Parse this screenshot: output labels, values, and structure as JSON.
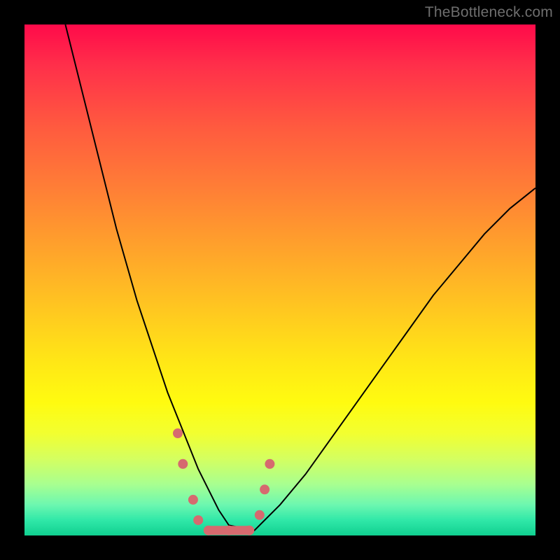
{
  "watermark": "TheBottleneck.com",
  "colors": {
    "background": "#000000",
    "gradient_top": "#ff0a4a",
    "gradient_bottom": "#10d090",
    "curve": "#000000",
    "markers": "#d66a6f"
  },
  "chart_data": {
    "type": "line",
    "title": "",
    "xlabel": "",
    "ylabel": "",
    "xlim": [
      0,
      100
    ],
    "ylim": [
      0,
      100
    ],
    "series": [
      {
        "name": "bottleneck-curve",
        "x": [
          8,
          10,
          12,
          14,
          16,
          18,
          20,
          22,
          24,
          26,
          28,
          30,
          32,
          34,
          36,
          38,
          40,
          45,
          50,
          55,
          60,
          65,
          70,
          75,
          80,
          85,
          90,
          95,
          100
        ],
        "y": [
          100,
          92,
          84,
          76,
          68,
          60,
          53,
          46,
          40,
          34,
          28,
          23,
          18,
          13,
          9,
          5,
          2,
          1,
          6,
          12,
          19,
          26,
          33,
          40,
          47,
          53,
          59,
          64,
          68
        ]
      }
    ],
    "markers": {
      "name": "optimal-range",
      "points": [
        {
          "x": 30,
          "y": 20
        },
        {
          "x": 31,
          "y": 14
        },
        {
          "x": 33,
          "y": 7
        },
        {
          "x": 34,
          "y": 3
        },
        {
          "x": 36,
          "y": 1
        },
        {
          "x": 40,
          "y": 1
        },
        {
          "x": 44,
          "y": 1
        },
        {
          "x": 46,
          "y": 4
        },
        {
          "x": 47,
          "y": 9
        },
        {
          "x": 48,
          "y": 14
        }
      ],
      "valley_segment": {
        "x_start": 36,
        "x_end": 44,
        "y": 1
      }
    }
  }
}
